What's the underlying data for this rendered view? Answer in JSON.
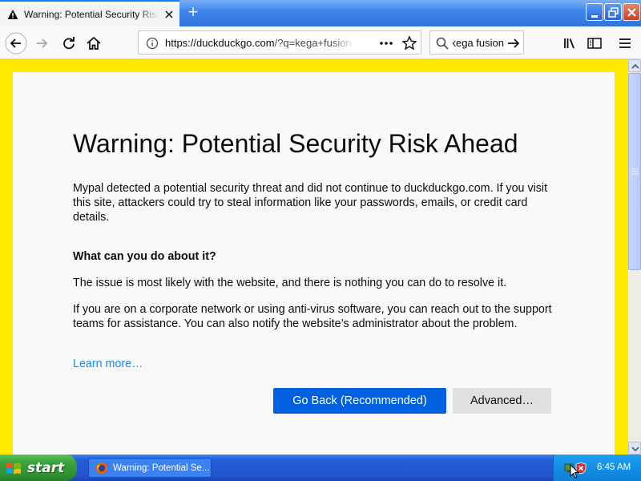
{
  "tab": {
    "title": "Warning: Potential Security Risk Ahead",
    "new_tab_glyph": "+"
  },
  "navbar": {
    "url_host": "https://duckduckgo.com",
    "url_rest": "/?q=kega+fusion",
    "search_value": "kega fusion"
  },
  "page": {
    "title": "Warning: Potential Security Risk Ahead",
    "intro": "Mypal detected a potential security threat and did not continue to duckduckgo.com. If you visit this site, attackers could try to steal information like your passwords, emails, or credit card details.",
    "subheading": "What can you do about it?",
    "para1": "The issue is most likely with the website, and there is nothing you can do to resolve it.",
    "para2": "If you are on a corporate network or using anti-virus software, you can reach out to the support teams for assistance. You can also notify the website’s administrator about the problem.",
    "learn_more": "Learn more…",
    "go_back_label": "Go Back (Recommended)",
    "advanced_label": "Advanced…"
  },
  "taskbar": {
    "start_label": "start",
    "task_label": "Warning: Potential Se...",
    "clock": "6:45 AM"
  },
  "colors": {
    "warning_band": "#ffe900",
    "primary_button": "#0060df",
    "link": "#0a8dff"
  },
  "icons": [
    "warning-icon",
    "tab-close-icon",
    "back-arrow-icon",
    "forward-arrow-icon",
    "reload-icon",
    "home-icon",
    "info-icon",
    "page-actions-icon",
    "bookmark-star-icon",
    "search-icon",
    "search-go-icon",
    "library-icon",
    "sidebar-icon",
    "hamburger-menu-icon",
    "windows-logo-icon",
    "firefox-icon",
    "network-icon",
    "security-alert-icon"
  ]
}
